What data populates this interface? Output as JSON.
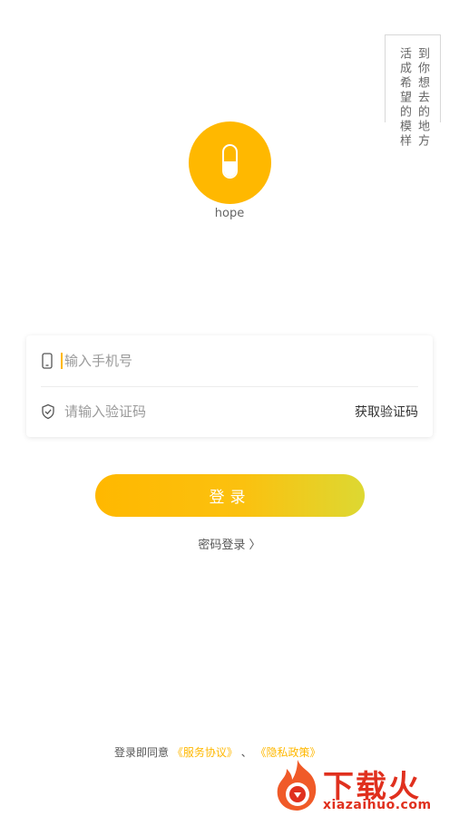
{
  "slogan": {
    "col1": "活成希望的模样",
    "col2": "到你想去的地方"
  },
  "brand": {
    "name": "hope"
  },
  "form": {
    "phone_placeholder": "输入手机号",
    "code_placeholder": "请输入验证码",
    "get_code_label": "获取验证码"
  },
  "login_button": "登录",
  "password_login": "密码登录 〉",
  "agreement": {
    "prefix": "登录即同意",
    "terms": "《服务协议》",
    "separator": "、",
    "privacy": "《隐私政策》"
  },
  "watermark": {
    "title": "下载火",
    "url": "xiazaihuo.com"
  },
  "colors": {
    "accent": "#FFB800",
    "gradient_end": "#DDD832",
    "watermark": "#E0301E"
  }
}
